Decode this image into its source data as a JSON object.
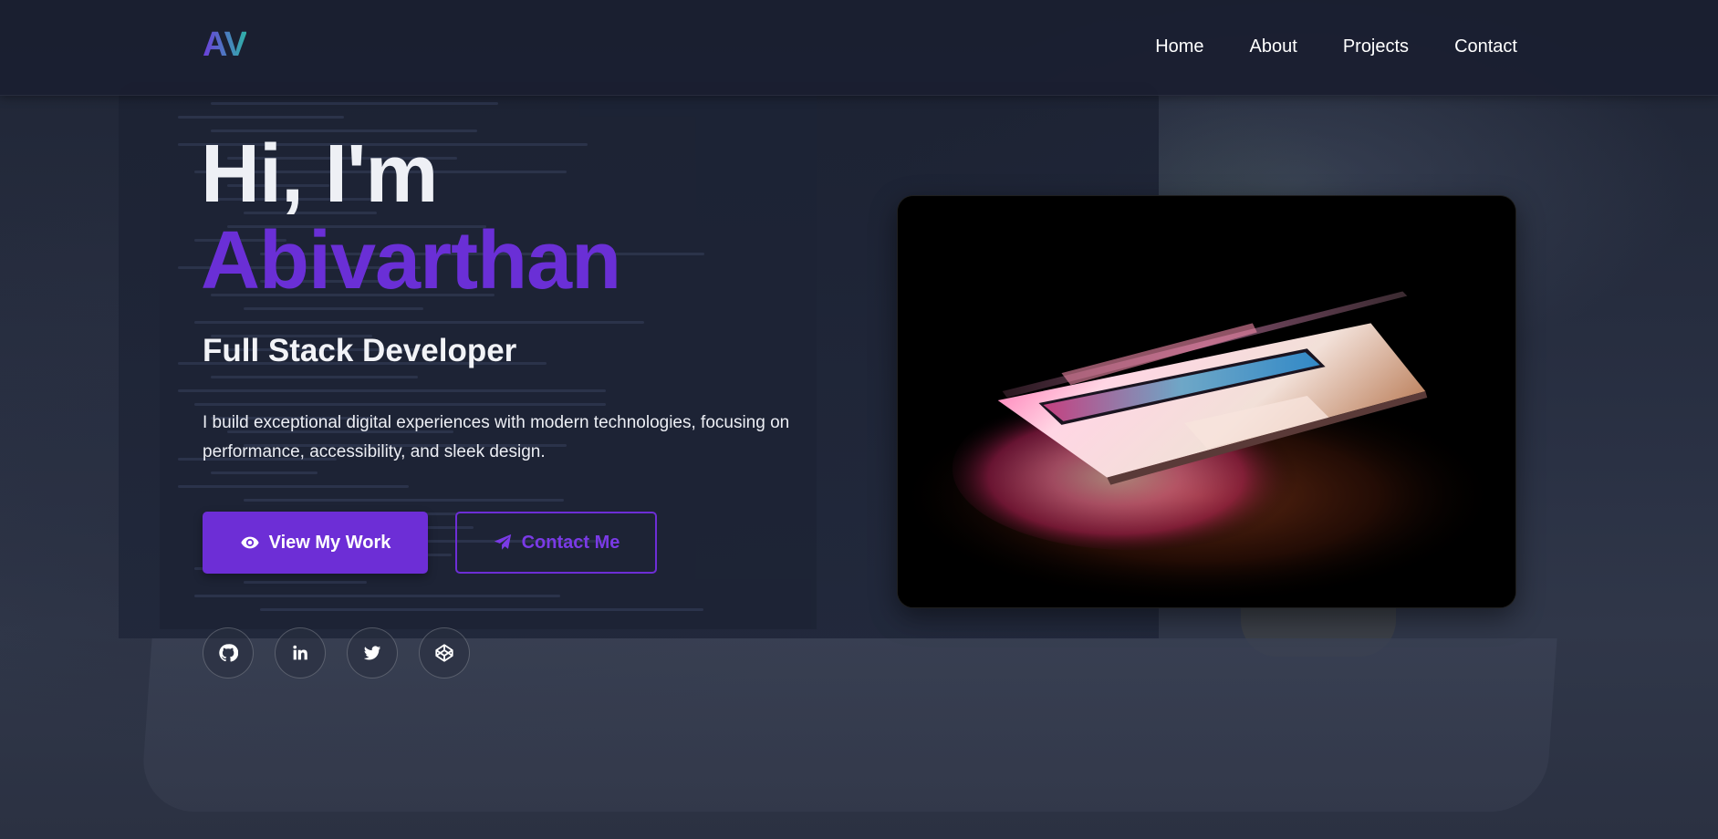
{
  "header": {
    "logo": "AV",
    "nav": [
      {
        "label": "Home"
      },
      {
        "label": "About"
      },
      {
        "label": "Projects"
      },
      {
        "label": "Contact"
      }
    ]
  },
  "hero": {
    "greeting": "Hi, I'm",
    "name": "Abivarthan",
    "role": "Full Stack Developer",
    "description": "I build exceptional digital experiences with modern technologies, focusing on performance, accessibility, and sleek design.",
    "primary_button": {
      "label": "View My Work",
      "icon": "eye-icon"
    },
    "secondary_button": {
      "label": "Contact Me",
      "icon": "paper-plane-icon"
    },
    "socials": [
      {
        "icon": "github-icon"
      },
      {
        "icon": "linkedin-icon"
      },
      {
        "icon": "twitter-icon"
      },
      {
        "icon": "codepen-icon"
      }
    ],
    "image_alt": "Glowing laptop"
  },
  "colors": {
    "accent": "#6d2ed6",
    "background": "#252b3d",
    "header": "#1a1f30"
  }
}
